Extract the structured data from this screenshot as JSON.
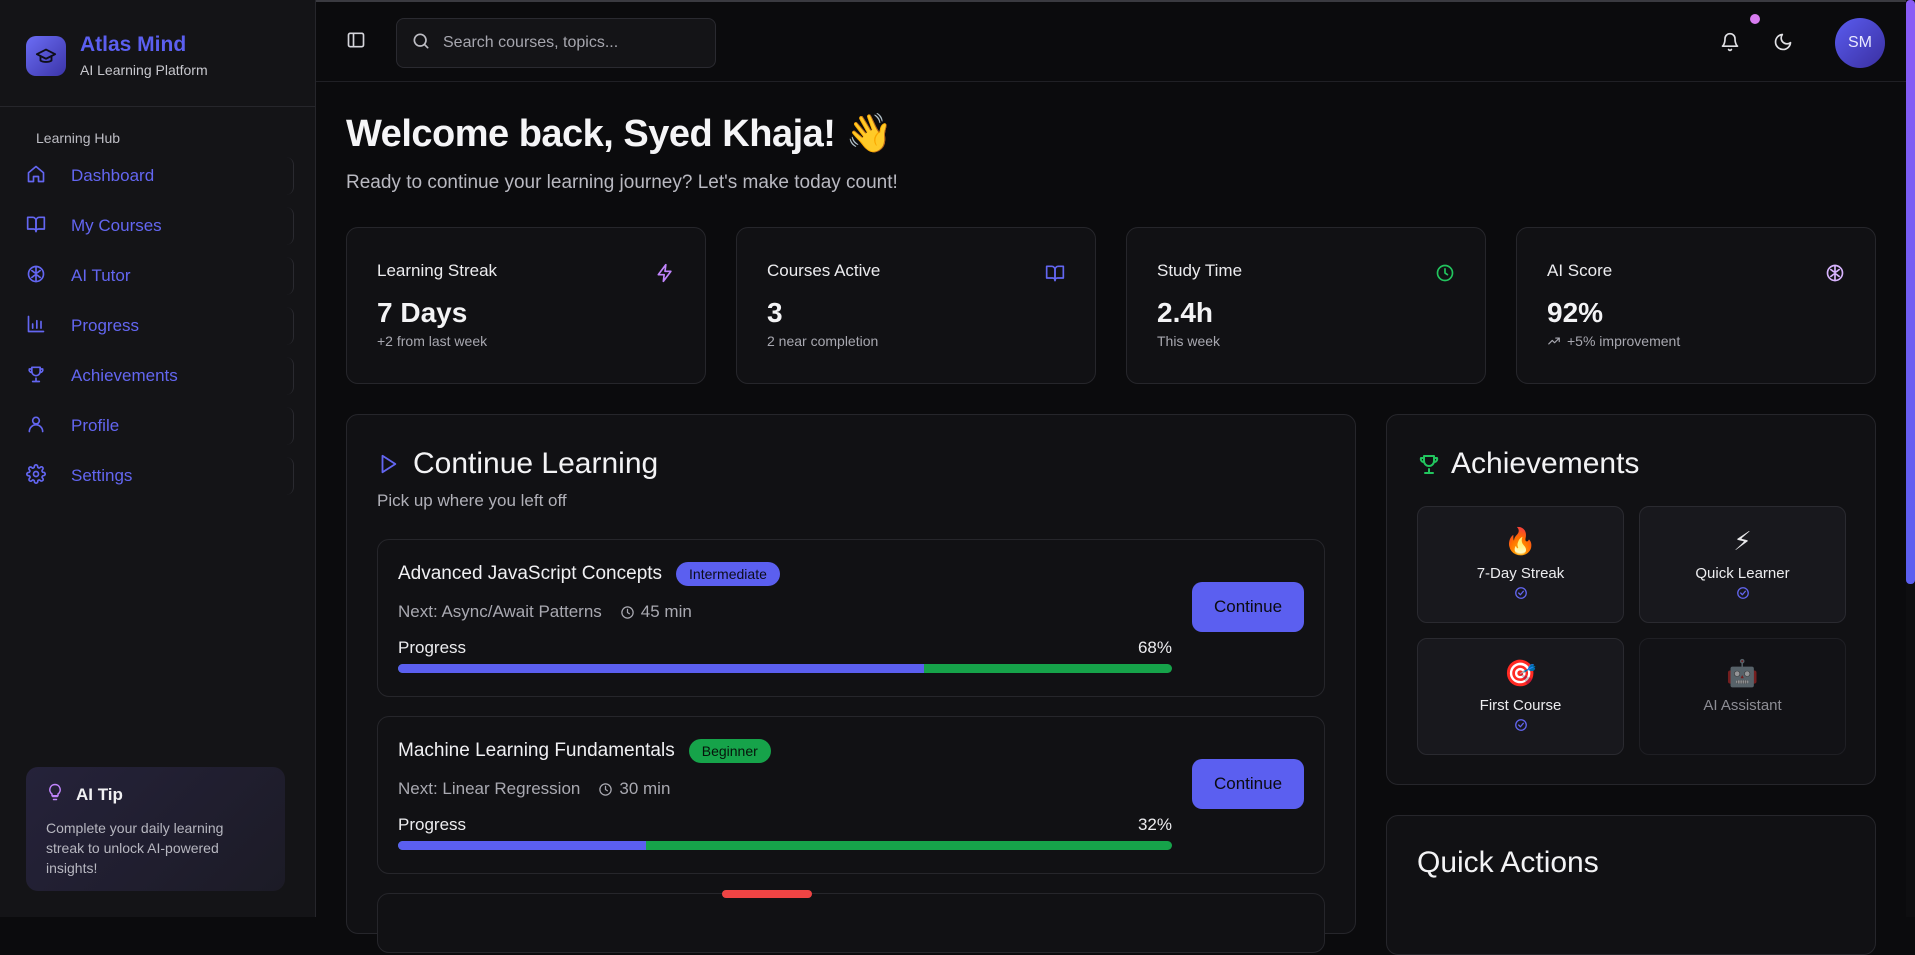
{
  "brand": {
    "title": "Atlas Mind",
    "subtitle": "AI Learning Platform"
  },
  "sidebar": {
    "section_label": "Learning Hub",
    "items": [
      {
        "label": "Dashboard",
        "icon": "home-icon"
      },
      {
        "label": "My Courses",
        "icon": "book-icon"
      },
      {
        "label": "AI Tutor",
        "icon": "brain-icon"
      },
      {
        "label": "Progress",
        "icon": "bar-chart-icon"
      },
      {
        "label": "Achievements",
        "icon": "trophy-icon"
      },
      {
        "label": "Profile",
        "icon": "user-icon"
      },
      {
        "label": "Settings",
        "icon": "gear-icon"
      }
    ],
    "tip": {
      "title": "AI Tip",
      "body": "Complete your daily learning streak to unlock AI-powered insights!"
    }
  },
  "topbar": {
    "search_placeholder": "Search courses, topics...",
    "avatar_initials": "SM"
  },
  "welcome": {
    "title": "Welcome back, Syed Khaja! 👋",
    "subtitle": "Ready to continue your learning journey? Let's make today count!"
  },
  "stats": [
    {
      "label": "Learning Streak",
      "value": "7 Days",
      "note": "+2 from last week",
      "icon": "zap-icon",
      "color": "#c084fc"
    },
    {
      "label": "Courses Active",
      "value": "3",
      "note": "2 near completion",
      "icon": "book-open-icon",
      "color": "#6366f1"
    },
    {
      "label": "Study Time",
      "value": "2.4h",
      "note": "This week",
      "icon": "clock-icon",
      "color": "#22c55e"
    },
    {
      "label": "AI Score",
      "value": "92%",
      "note": "+5% improvement",
      "icon": "brain-icon",
      "color": "#d8b4fe"
    }
  ],
  "continue_learning": {
    "title": "Continue Learning",
    "subtitle": "Pick up where you left off",
    "progress_label": "Progress",
    "button_label": "Continue",
    "courses": [
      {
        "name": "Advanced JavaScript Concepts",
        "level": "Intermediate",
        "level_color": "#5b5ff0",
        "next": "Next: Async/Await Patterns",
        "duration": "45 min",
        "progress": 68,
        "progress_text": "68%"
      },
      {
        "name": "Machine Learning Fundamentals",
        "level": "Beginner",
        "level_color": "#16a34a",
        "next": "Next: Linear Regression",
        "duration": "30 min",
        "progress": 32,
        "progress_text": "32%"
      }
    ]
  },
  "achievements": {
    "title": "Achievements",
    "items": [
      {
        "label": "7-Day Streak",
        "emoji": "🔥",
        "earned": true
      },
      {
        "label": "Quick Learner",
        "emoji": "⚡",
        "earned": true
      },
      {
        "label": "First Course",
        "emoji": "🎯",
        "earned": true
      },
      {
        "label": "AI Assistant",
        "emoji": "🤖",
        "earned": false
      }
    ]
  },
  "quick_actions": {
    "title": "Quick Actions"
  }
}
